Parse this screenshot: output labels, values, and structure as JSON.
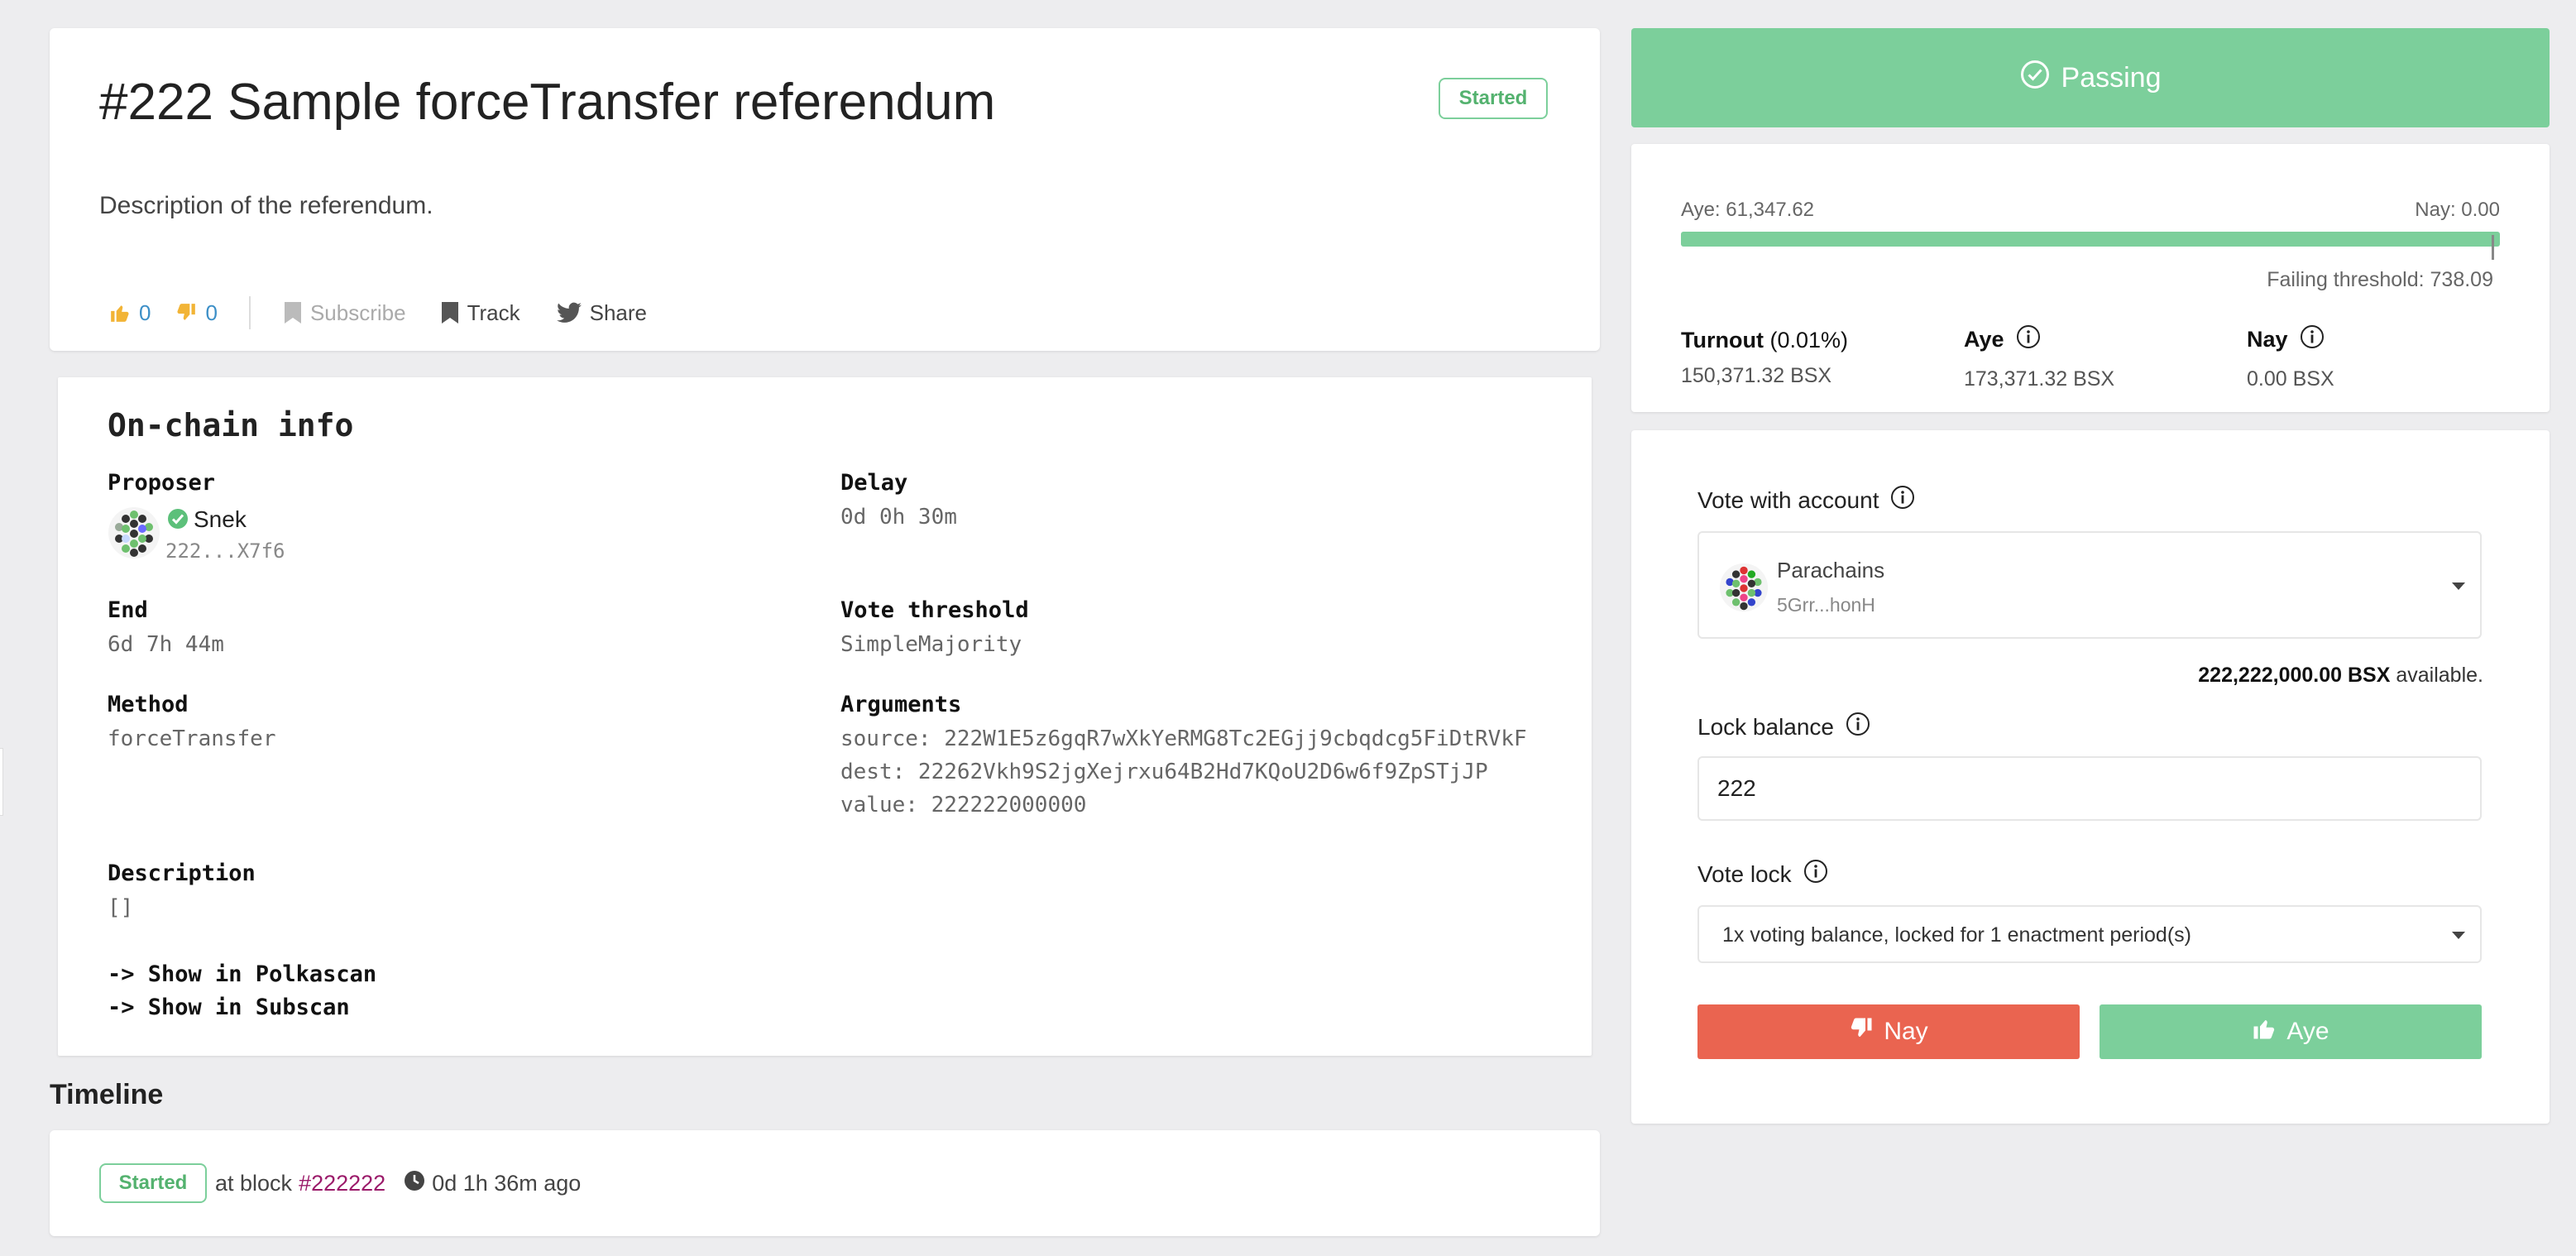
{
  "referendum": {
    "title": "#222 Sample forceTransfer referendum",
    "status": "Started",
    "description": "Description of the referendum."
  },
  "actions": {
    "upvotes": "0",
    "downvotes": "0",
    "subscribe_label": "Subscribe",
    "track_label": "Track",
    "share_label": "Share"
  },
  "onchain": {
    "title": "On-chain info",
    "proposer_label": "Proposer",
    "proposer_name": "Snek",
    "proposer_address": "222...X7f6",
    "delay_label": "Delay",
    "delay_value": "0d 0h 30m",
    "end_label": "End",
    "end_value": "6d 7h 44m",
    "threshold_label": "Vote threshold",
    "threshold_value": "SimpleMajority",
    "method_label": "Method",
    "method_value": "forceTransfer",
    "arguments_label": "Arguments",
    "arguments": [
      "source: 222W1E5z6gqR7wXkYeRMG8Tc2EGjj9cbqdcg5FiDtRVkF",
      "dest: 22262Vkh9S2jgXejrxu64B2Hd7KQoU2D6w6f9ZpSTjJP",
      "value: 222222000000"
    ],
    "description_label": "Description",
    "description_value": "[]",
    "links": [
      "-> Show in Polkascan",
      "-> Show in Subscan"
    ]
  },
  "timeline": {
    "title": "Timeline",
    "badge": "Started",
    "at_block_text": "at block",
    "block": "#222222",
    "time_ago": "0d 1h 36m ago"
  },
  "tally": {
    "banner": "Passing",
    "aye_summary": "Aye: 61,347.62",
    "nay_summary": "Nay: 0.00",
    "aye_fraction": 1.0,
    "failing_threshold": "Failing threshold: 738.09",
    "turnout_label": "Turnout",
    "turnout_pct": "(0.01%)",
    "turnout_value": "150,371.32 BSX",
    "aye_label": "Aye",
    "aye_value": "173,371.32 BSX",
    "nay_label": "Nay",
    "nay_value": "0.00 BSX"
  },
  "vote": {
    "account_label": "Vote with account",
    "account_name": "Parachains",
    "account_address": "5Grr...honH",
    "available_amount": "222,222,000.00 BSX",
    "available_suffix": "available.",
    "lock_balance_label": "Lock balance",
    "lock_balance_value": "222",
    "vote_lock_label": "Vote lock",
    "vote_lock_value": "1x voting balance, locked for 1 enactment period(s)",
    "nay_button": "Nay",
    "aye_button": "Aye"
  },
  "colors": {
    "passing": "#7ccf9b",
    "nay": "#ea6450",
    "block_link": "#9b1b6a"
  }
}
